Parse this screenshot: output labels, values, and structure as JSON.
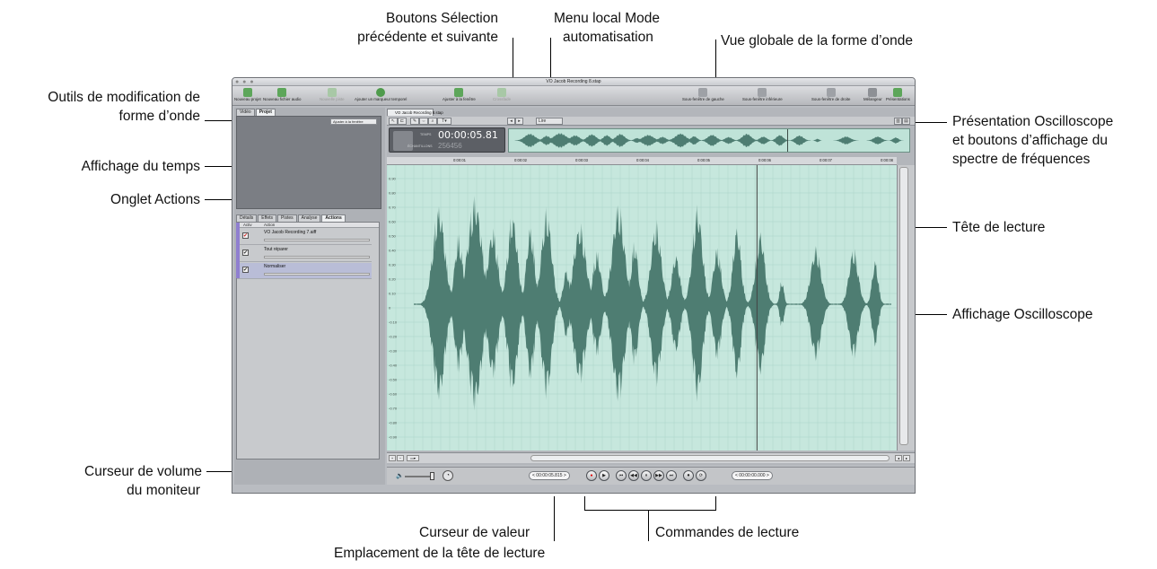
{
  "window": {
    "title": "VO Jacob Recording 8.stap",
    "controls": "● ● ●"
  },
  "toolbar": [
    {
      "label": "Nouveau projet",
      "icon": "new-project-icon",
      "enabled": true
    },
    {
      "label": "Nouveau fichier audio",
      "icon": "new-audio-file-icon",
      "enabled": true
    },
    {
      "label": "Nouvelle piste",
      "icon": "new-track-icon",
      "enabled": false
    },
    {
      "label": "Ajouter un marqueur temporel",
      "icon": "add-marker-icon",
      "enabled": true
    },
    {
      "label": "Ajuster à la fenêtre",
      "icon": "fit-window-icon",
      "enabled": true
    },
    {
      "label": "Crossfade",
      "icon": "crossfade-icon",
      "enabled": false
    },
    {
      "label": "Sous-fenêtre de gauche",
      "icon": "left-pane-icon",
      "enabled": true
    },
    {
      "label": "Sous-fenêtre inférieure",
      "icon": "bottom-pane-icon",
      "enabled": true
    },
    {
      "label": "Sous-fenêtre de droite",
      "icon": "right-pane-icon",
      "enabled": true
    },
    {
      "label": "Mélangeur",
      "icon": "mixer-icon",
      "enabled": true
    },
    {
      "label": "Présentations",
      "icon": "layouts-icon",
      "enabled": true
    }
  ],
  "left_panel": {
    "top_tabs": [
      "Vidéo",
      "Projet"
    ],
    "active_top_tab": "Projet",
    "fit_select": "Ajuster à la fenêtre",
    "bottom_tabs": [
      "Détails",
      "Effets",
      "Pistes",
      "Analyse",
      "Actions"
    ],
    "active_bottom_tab": "Actions",
    "actions_header": {
      "col1": "Activ",
      "col2": "Action"
    },
    "actions": [
      {
        "name": "VO Jacob Recording 7.aiff",
        "check": "✔"
      },
      {
        "name": "Tout réparer",
        "check": "✔"
      },
      {
        "name": "Normaliser",
        "check": "✔"
      }
    ],
    "gear": "⚙ ▾"
  },
  "editor": {
    "doc_tab": "VO Jacob Recording 8.stap",
    "automation_menu": "Lire",
    "time_label": "TEMPS",
    "time_value": "00:00:05.81",
    "sample_label": "ÉCHANTILLONS",
    "sample_value": "256456",
    "ruler_ticks": [
      "0:00:01",
      "0:00:02",
      "0:00:03",
      "0:00:04",
      "0:00:05",
      "0:00:06",
      "0:00:07",
      "0:00:08"
    ],
    "y_labels": [
      "0.90",
      "0.80",
      "0.70",
      "0.60",
      "0.50",
      "0.40",
      "0.30",
      "0.20",
      "0.10",
      "0",
      "-0.10",
      "-0.20",
      "-0.30",
      "-0.40",
      "-0.50",
      "-0.60",
      "-0.70",
      "-0.80",
      "-0.90"
    ],
    "playhead_fraction": 0.726
  },
  "transport": {
    "value_slider_field": "< 00:00:05.815 >",
    "end_field": "< 00:00:00.000 >",
    "buttons": [
      "●",
      "▶",
      "⏮",
      "◀◀",
      "⏸",
      "▶▶",
      "⏭",
      "⏺",
      "⟳"
    ]
  },
  "colors": {
    "waveform": "#4e7d72",
    "wave_bg": "#c6e7dd",
    "grid": "#a9d3c7",
    "playhead": "#444444"
  },
  "callouts": {
    "selection_buttons": [
      "Boutons Sélection",
      "précédente et suivante"
    ],
    "automation_menu": [
      "Menu local Mode",
      "automatisation"
    ],
    "overview": [
      "Vue globale de la forme d’onde"
    ],
    "waveform_tools": [
      "Outils de modification de",
      "forme d’onde"
    ],
    "scope_view": [
      "Présentation Oscilloscope",
      "et boutons d’affichage du",
      "spectre de fréquences"
    ],
    "time_display": [
      "Affichage du temps"
    ],
    "actions_tab": [
      "Onglet Actions"
    ],
    "playhead": [
      "Tête de lecture"
    ],
    "scope_display": [
      "Affichage Oscilloscope"
    ],
    "monitor_volume": [
      "Curseur de volume",
      "du moniteur"
    ],
    "value_slider": [
      "Curseur de valeur"
    ],
    "playhead_location": [
      "Emplacement de la tête de lecture"
    ],
    "transport_controls": [
      "Commandes de lecture"
    ]
  }
}
